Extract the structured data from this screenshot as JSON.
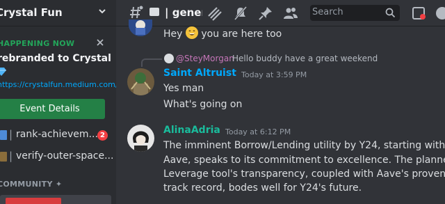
{
  "server": {
    "name": "Crystal Fun"
  },
  "event": {
    "status": "HAPPENING NOW",
    "title": "rebranded to Crystal",
    "link": "https://crystalfun.medium.com/we-",
    "button_label": "Event Details"
  },
  "channels": [
    {
      "pipe": "|",
      "name": "rank-achievem...",
      "badge": "2"
    },
    {
      "pipe": "|",
      "name": "verify-outer-space..."
    }
  ],
  "category": {
    "label": "COMMUNITY ✦"
  },
  "header": {
    "channel_title": "| general",
    "search_placeholder": "Search"
  },
  "messages": [
    {
      "text_before": "Hey ",
      "text_after": " you are here too"
    },
    {
      "reply": {
        "user": "@SteyMorgan",
        "text": "Hello buddy have a great weekend"
      },
      "author": "Saint Altruist",
      "author_color": "#00a8fc",
      "timestamp": "Today at 3:59 PM",
      "lines": [
        "Yes man",
        "What's going on"
      ]
    },
    {
      "author": "AlinaAdria",
      "author_color": "#1abc9c",
      "timestamp": "Today at 6:12 PM",
      "lines": [
        "The imminent Borrow/Lending utility by Y24, starting with",
        "Aave, speaks to its commitment to excellence. The planned",
        "Leverage tool's transparency, coupled with Aave's proven",
        "track record, bodes well for Y24's future."
      ]
    }
  ],
  "colors": {
    "accent": "#5865f2",
    "green": "#248046",
    "link": "#00a8fc",
    "badge": "#f23f43"
  },
  "icons": [
    "threads-icon",
    "notification-settings-icon",
    "mute-icon",
    "pin-icon",
    "member-list-icon",
    "search-icon",
    "inbox-icon",
    "help-icon"
  ]
}
